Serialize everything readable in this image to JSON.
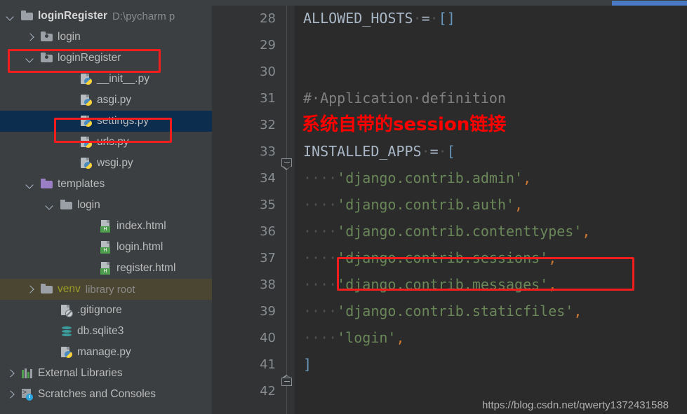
{
  "window": {
    "scrollbar_color": "#4779c4"
  },
  "sidebar": {
    "items": [
      {
        "label": "loginRegister",
        "sub": "D:\\pycharm p",
        "icon": "folder-icon",
        "indent": 0,
        "arrow": "down",
        "kind": "folder",
        "bold": true,
        "state": "normal"
      },
      {
        "label": "login",
        "sub": "",
        "icon": "module-folder-icon",
        "indent": 1,
        "arrow": "right",
        "kind": "modfolder",
        "bold": false,
        "state": "normal"
      },
      {
        "label": "loginRegister",
        "sub": "",
        "icon": "module-folder-icon",
        "indent": 1,
        "arrow": "down",
        "kind": "modfolder",
        "bold": false,
        "state": "normal"
      },
      {
        "label": "__init__.py",
        "sub": "",
        "icon": "python-file-icon",
        "indent": 3,
        "arrow": "none",
        "kind": "py",
        "bold": false,
        "state": "normal"
      },
      {
        "label": "asgi.py",
        "sub": "",
        "icon": "python-file-icon",
        "indent": 3,
        "arrow": "none",
        "kind": "py",
        "bold": false,
        "state": "normal"
      },
      {
        "label": "settings.py",
        "sub": "",
        "icon": "python-file-icon",
        "indent": 3,
        "arrow": "none",
        "kind": "py",
        "bold": false,
        "state": "selected"
      },
      {
        "label": "urls.py",
        "sub": "",
        "icon": "python-file-icon",
        "indent": 3,
        "arrow": "none",
        "kind": "py",
        "bold": false,
        "state": "normal"
      },
      {
        "label": "wsgi.py",
        "sub": "",
        "icon": "python-file-icon",
        "indent": 3,
        "arrow": "none",
        "kind": "py",
        "bold": false,
        "state": "normal"
      },
      {
        "label": "templates",
        "sub": "",
        "icon": "folder-icon",
        "indent": 1,
        "arrow": "down",
        "kind": "folder-purple",
        "bold": false,
        "state": "normal"
      },
      {
        "label": "login",
        "sub": "",
        "icon": "folder-icon",
        "indent": 2,
        "arrow": "down",
        "kind": "folder",
        "bold": false,
        "state": "normal"
      },
      {
        "label": "index.html",
        "sub": "",
        "icon": "html-file-icon",
        "indent": 4,
        "arrow": "none",
        "kind": "html",
        "bold": false,
        "state": "normal"
      },
      {
        "label": "login.html",
        "sub": "",
        "icon": "html-file-icon",
        "indent": 4,
        "arrow": "none",
        "kind": "html",
        "bold": false,
        "state": "normal"
      },
      {
        "label": "register.html",
        "sub": "",
        "icon": "html-file-icon",
        "indent": 4,
        "arrow": "none",
        "kind": "html",
        "bold": false,
        "state": "normal"
      },
      {
        "label": "venv",
        "sub": "library root",
        "icon": "folder-icon",
        "indent": 1,
        "arrow": "right",
        "kind": "folder",
        "bold": false,
        "state": "libroot"
      },
      {
        "label": ".gitignore",
        "sub": "",
        "icon": "gitignore-file-icon",
        "indent": 2,
        "arrow": "none",
        "kind": "git",
        "bold": false,
        "state": "normal"
      },
      {
        "label": "db.sqlite3",
        "sub": "",
        "icon": "database-icon",
        "indent": 2,
        "arrow": "none",
        "kind": "db",
        "bold": false,
        "state": "normal"
      },
      {
        "label": "manage.py",
        "sub": "",
        "icon": "python-file-icon",
        "indent": 2,
        "arrow": "none",
        "kind": "py",
        "bold": false,
        "state": "normal"
      },
      {
        "label": "External Libraries",
        "sub": "",
        "icon": "libraries-icon",
        "indent": 0,
        "arrow": "right",
        "kind": "bars",
        "bold": false,
        "state": "normal"
      },
      {
        "label": "Scratches and Consoles",
        "sub": "",
        "icon": "scratches-icon",
        "indent": 0,
        "arrow": "right",
        "kind": "scratch",
        "bold": false,
        "state": "normal"
      }
    ],
    "html_icon_letter": "H"
  },
  "editor": {
    "line_numbers": [
      28,
      29,
      30,
      31,
      32,
      33,
      34,
      35,
      36,
      37,
      38,
      39,
      40,
      41,
      42
    ],
    "lines": [
      {
        "n": 28,
        "tokens": [
          {
            "t": "ALLOWED_HOSTS",
            "c": "var"
          },
          {
            "t": "·",
            "c": "ws"
          },
          {
            "t": "=",
            "c": "op"
          },
          {
            "t": "·",
            "c": "ws"
          },
          {
            "t": "[]",
            "c": "brk"
          }
        ]
      },
      {
        "n": 29,
        "tokens": []
      },
      {
        "n": 30,
        "tokens": []
      },
      {
        "n": 31,
        "tokens": [
          {
            "t": "#·Application·definition",
            "c": "comment"
          }
        ]
      },
      {
        "n": 32,
        "tokens": []
      },
      {
        "n": 33,
        "tokens": [
          {
            "t": "INSTALLED_APPS",
            "c": "var"
          },
          {
            "t": "·",
            "c": "ws"
          },
          {
            "t": "=",
            "c": "op"
          },
          {
            "t": "·",
            "c": "ws"
          },
          {
            "t": "[",
            "c": "brk"
          }
        ]
      },
      {
        "n": 34,
        "tokens": [
          {
            "t": "····",
            "c": "ws"
          },
          {
            "t": "'django.contrib.admin'",
            "c": "str"
          },
          {
            "t": ",",
            "c": "comma"
          }
        ]
      },
      {
        "n": 35,
        "tokens": [
          {
            "t": "····",
            "c": "ws"
          },
          {
            "t": "'django.contrib.auth'",
            "c": "str"
          },
          {
            "t": ",",
            "c": "comma"
          }
        ]
      },
      {
        "n": 36,
        "tokens": [
          {
            "t": "····",
            "c": "ws"
          },
          {
            "t": "'django.contrib.contenttypes'",
            "c": "str"
          },
          {
            "t": ",",
            "c": "comma"
          }
        ]
      },
      {
        "n": 37,
        "tokens": [
          {
            "t": "····",
            "c": "ws"
          },
          {
            "t": "'django.contrib.sessions'",
            "c": "str"
          },
          {
            "t": ",",
            "c": "comma"
          }
        ]
      },
      {
        "n": 38,
        "tokens": [
          {
            "t": "····",
            "c": "ws"
          },
          {
            "t": "'django.contrib.messages'",
            "c": "str"
          },
          {
            "t": ",",
            "c": "comma"
          }
        ]
      },
      {
        "n": 39,
        "tokens": [
          {
            "t": "····",
            "c": "ws"
          },
          {
            "t": "'django.contrib.staticfiles'",
            "c": "str"
          },
          {
            "t": ",",
            "c": "comma"
          }
        ]
      },
      {
        "n": 40,
        "tokens": [
          {
            "t": "····",
            "c": "ws"
          },
          {
            "t": "'login'",
            "c": "str"
          },
          {
            "t": ",",
            "c": "comma"
          }
        ]
      },
      {
        "n": 41,
        "tokens": [
          {
            "t": "]",
            "c": "brk"
          }
        ]
      },
      {
        "n": 42,
        "tokens": []
      }
    ]
  },
  "annotations": {
    "chinese_note": "系统自带的session链接",
    "note_color": "#ff0000",
    "box_color": "#f41d1d"
  },
  "watermark": {
    "text": "https://blog.csdn.net/qwerty1372431588"
  }
}
